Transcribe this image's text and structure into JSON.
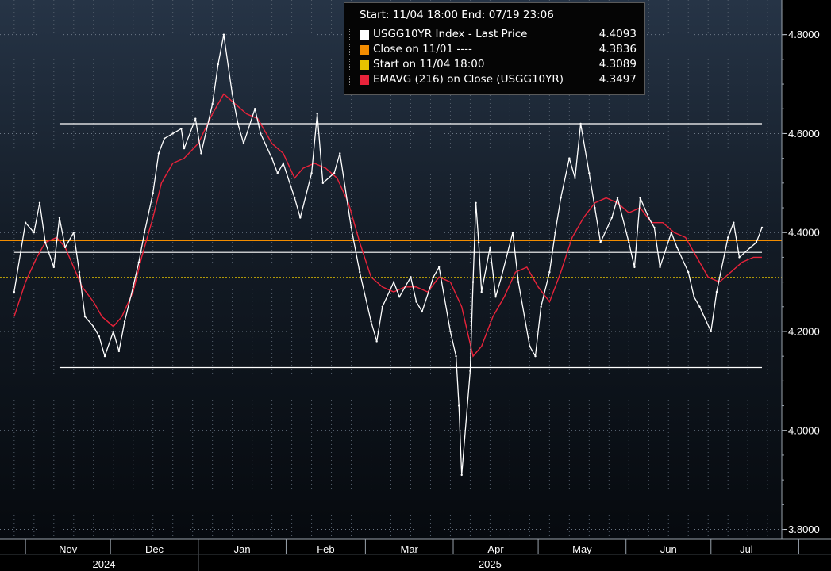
{
  "chart_data": {
    "type": "line",
    "header": "Start: 11/04 18:00 End: 07/19 23:06",
    "ylim": [
      3.78,
      4.87
    ],
    "grid": true,
    "y_ticks": [
      "4.8000",
      "4.6000",
      "4.4000",
      "4.2000",
      "4.0000",
      "3.8000"
    ],
    "month_labels": [
      "Nov",
      "Dec",
      "Jan",
      "Feb",
      "Mar",
      "Apr",
      "May",
      "Jun",
      "Jul"
    ],
    "year_labels": [
      "2024",
      "2025"
    ],
    "colors": {
      "price": "#ffffff",
      "close": "#f28c00",
      "start": "#e6c200",
      "ema": "#e8233a",
      "hline": "#ffffff"
    },
    "legend": [
      {
        "label": "USGG10YR Index - Last Price",
        "value": "4.4093",
        "color": "#ffffff"
      },
      {
        "label": "Close on 11/01 ----",
        "value": "4.3836",
        "color": "#f28c00"
      },
      {
        "label": "Start on 11/04 18:00",
        "value": "4.3089",
        "color": "#e6c200"
      },
      {
        "label": "EMAVG (216)  on Close (USGG10YR)",
        "value": "4.3497",
        "color": "#e8233a"
      }
    ],
    "reference_levels": {
      "close": 4.3836,
      "start": 4.3089
    },
    "horizontal_lines": [
      {
        "start": "2024-11-13",
        "end": "2025-07-19",
        "value": 4.62
      },
      {
        "start": "2024-10-28",
        "end": "2025-07-19",
        "value": 4.36
      },
      {
        "start": "2024-11-13",
        "end": "2025-07-19",
        "value": 4.127
      }
    ],
    "price_series": {
      "name": "USGG10YR Index - Last Price",
      "x": [
        "2024-10-28",
        "2024-11-01",
        "2024-11-04",
        "2024-11-06",
        "2024-11-08",
        "2024-11-11",
        "2024-11-13",
        "2024-11-15",
        "2024-11-18",
        "2024-11-20",
        "2024-11-22",
        "2024-11-25",
        "2024-11-27",
        "2024-11-29",
        "2024-12-02",
        "2024-12-04",
        "2024-12-06",
        "2024-12-09",
        "2024-12-11",
        "2024-12-13",
        "2024-12-16",
        "2024-12-18",
        "2024-12-20",
        "2024-12-23",
        "2024-12-26",
        "2024-12-27",
        "2024-12-31",
        "2025-01-02",
        "2025-01-06",
        "2025-01-08",
        "2025-01-10",
        "2025-01-13",
        "2025-01-15",
        "2025-01-17",
        "2025-01-21",
        "2025-01-23",
        "2025-01-27",
        "2025-01-29",
        "2025-01-31",
        "2025-02-04",
        "2025-02-06",
        "2025-02-10",
        "2025-02-12",
        "2025-02-14",
        "2025-02-18",
        "2025-02-20",
        "2025-02-24",
        "2025-02-27",
        "2025-03-03",
        "2025-03-05",
        "2025-03-07",
        "2025-03-11",
        "2025-03-13",
        "2025-03-17",
        "2025-03-19",
        "2025-03-21",
        "2025-03-25",
        "2025-03-27",
        "2025-03-31",
        "2025-04-02",
        "2025-04-03",
        "2025-04-04",
        "2025-04-07",
        "2025-04-08",
        "2025-04-09",
        "2025-04-10",
        "2025-04-11",
        "2025-04-14",
        "2025-04-16",
        "2025-04-18",
        "2025-04-22",
        "2025-04-24",
        "2025-04-28",
        "2025-04-30",
        "2025-05-02",
        "2025-05-05",
        "2025-05-07",
        "2025-05-09",
        "2025-05-12",
        "2025-05-14",
        "2025-05-16",
        "2025-05-19",
        "2025-05-21",
        "2025-05-23",
        "2025-05-27",
        "2025-05-29",
        "2025-06-02",
        "2025-06-04",
        "2025-06-06",
        "2025-06-09",
        "2025-06-11",
        "2025-06-13",
        "2025-06-17",
        "2025-06-19",
        "2025-06-23",
        "2025-06-25",
        "2025-06-27",
        "2025-07-01",
        "2025-07-03",
        "2025-07-07",
        "2025-07-09",
        "2025-07-11",
        "2025-07-15",
        "2025-07-17",
        "2025-07-19"
      ],
      "values": [
        4.28,
        4.42,
        4.4,
        4.46,
        4.38,
        4.33,
        4.43,
        4.37,
        4.4,
        4.32,
        4.23,
        4.21,
        4.19,
        4.15,
        4.2,
        4.16,
        4.22,
        4.29,
        4.34,
        4.4,
        4.48,
        4.56,
        4.59,
        4.6,
        4.61,
        4.57,
        4.63,
        4.56,
        4.66,
        4.74,
        4.8,
        4.68,
        4.62,
        4.58,
        4.65,
        4.6,
        4.55,
        4.52,
        4.54,
        4.47,
        4.43,
        4.52,
        4.64,
        4.5,
        4.52,
        4.56,
        4.41,
        4.32,
        4.22,
        4.18,
        4.25,
        4.3,
        4.27,
        4.31,
        4.26,
        4.24,
        4.31,
        4.33,
        4.2,
        4.15,
        4.05,
        3.91,
        4.12,
        4.3,
        4.46,
        4.38,
        4.28,
        4.37,
        4.27,
        4.31,
        4.4,
        4.3,
        4.17,
        4.15,
        4.25,
        4.32,
        4.4,
        4.47,
        4.55,
        4.51,
        4.62,
        4.52,
        4.45,
        4.38,
        4.43,
        4.47,
        4.38,
        4.33,
        4.47,
        4.43,
        4.41,
        4.33,
        4.4,
        4.37,
        4.32,
        4.27,
        4.25,
        4.2,
        4.28,
        4.39,
        4.42,
        4.35,
        4.37,
        4.38,
        4.41
      ]
    },
    "ema_series": {
      "name": "EMAVG (216)  on Close (USGG10YR)",
      "x": [
        "2024-10-28",
        "2024-11-01",
        "2024-11-05",
        "2024-11-08",
        "2024-11-12",
        "2024-11-15",
        "2024-11-18",
        "2024-11-21",
        "2024-11-25",
        "2024-11-28",
        "2024-12-02",
        "2024-12-05",
        "2024-12-09",
        "2024-12-12",
        "2024-12-16",
        "2024-12-19",
        "2024-12-23",
        "2024-12-27",
        "2025-01-01",
        "2025-01-06",
        "2025-01-10",
        "2025-01-14",
        "2025-01-18",
        "2025-01-22",
        "2025-01-27",
        "2025-01-31",
        "2025-02-04",
        "2025-02-07",
        "2025-02-11",
        "2025-02-15",
        "2025-02-19",
        "2025-02-23",
        "2025-02-27",
        "2025-03-03",
        "2025-03-07",
        "2025-03-11",
        "2025-03-15",
        "2025-03-19",
        "2025-03-23",
        "2025-03-27",
        "2025-03-31",
        "2025-04-04",
        "2025-04-08",
        "2025-04-11",
        "2025-04-15",
        "2025-04-19",
        "2025-04-23",
        "2025-04-27",
        "2025-05-01",
        "2025-05-05",
        "2025-05-09",
        "2025-05-13",
        "2025-05-17",
        "2025-05-21",
        "2025-05-25",
        "2025-05-29",
        "2025-06-02",
        "2025-06-06",
        "2025-06-10",
        "2025-06-14",
        "2025-06-18",
        "2025-06-22",
        "2025-06-26",
        "2025-06-30",
        "2025-07-04",
        "2025-07-08",
        "2025-07-12",
        "2025-07-16",
        "2025-07-19"
      ],
      "values": [
        4.23,
        4.3,
        4.35,
        4.38,
        4.39,
        4.37,
        4.33,
        4.29,
        4.26,
        4.23,
        4.21,
        4.23,
        4.28,
        4.35,
        4.43,
        4.5,
        4.54,
        4.55,
        4.58,
        4.64,
        4.68,
        4.66,
        4.64,
        4.63,
        4.58,
        4.56,
        4.51,
        4.53,
        4.54,
        4.53,
        4.51,
        4.46,
        4.38,
        4.31,
        4.29,
        4.28,
        4.29,
        4.29,
        4.28,
        4.31,
        4.3,
        4.25,
        4.15,
        4.17,
        4.23,
        4.27,
        4.32,
        4.33,
        4.29,
        4.26,
        4.32,
        4.39,
        4.43,
        4.46,
        4.47,
        4.46,
        4.44,
        4.45,
        4.42,
        4.42,
        4.4,
        4.39,
        4.35,
        4.31,
        4.3,
        4.32,
        4.34,
        4.35,
        4.35
      ]
    }
  }
}
